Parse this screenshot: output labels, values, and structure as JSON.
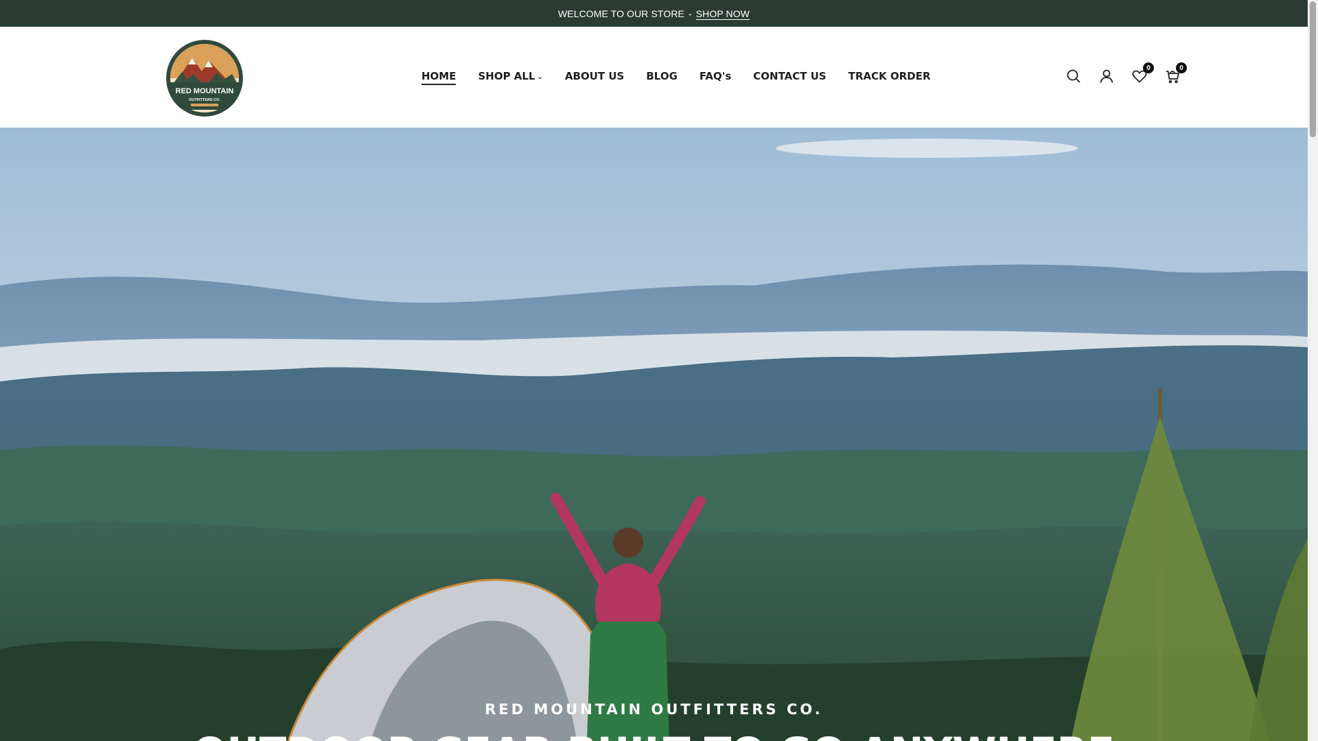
{
  "announcement": {
    "text": "WELCOME TO OUR STORE",
    "separator": "-",
    "link_label": "SHOP NOW"
  },
  "logo": {
    "brand_line1": "RED MOUNTAIN",
    "brand_line2": "OUTFITTERS CO."
  },
  "nav": {
    "items": [
      {
        "label": "HOME",
        "active": true
      },
      {
        "label": "SHOP ALL",
        "has_dropdown": true
      },
      {
        "label": "ABOUT US"
      },
      {
        "label": "BLOG"
      },
      {
        "label": "FAQ's"
      },
      {
        "label": "CONTACT US"
      },
      {
        "label": "TRACK ORDER"
      }
    ],
    "dropdown_icon": "chevron-down-icon"
  },
  "header_icons": {
    "search": "search-icon",
    "account": "user-icon",
    "wishlist": "heart-icon",
    "wishlist_count": "0",
    "cart": "cart-icon",
    "cart_count": "0"
  },
  "hero": {
    "subtitle": "RED MOUNTAIN OUTFITTERS CO.",
    "title": "OUTDOOR GEAR BUILT TO GO ANYWHERE"
  },
  "colors": {
    "announcement_bg": "#2b3b33",
    "accent_green": "#2f4a3c"
  }
}
